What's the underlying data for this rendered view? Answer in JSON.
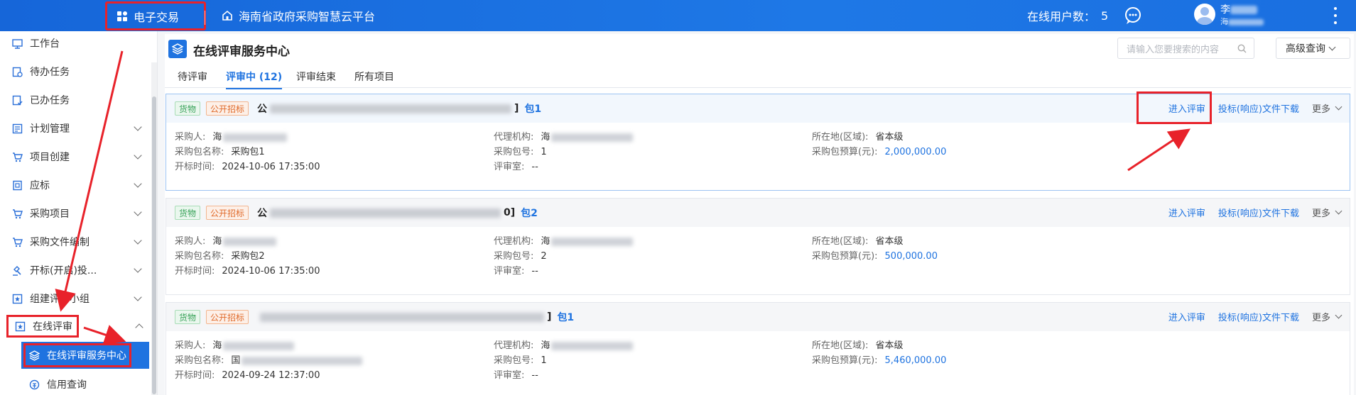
{
  "topbar": {
    "app_label": "电子交易",
    "platform_label": "海南省政府采购智慧云平台",
    "online_label": "在线用户数：",
    "online_count": "5",
    "user_name": "李",
    "user_org": "海"
  },
  "sidebar": {
    "items": [
      {
        "label": "工作台"
      },
      {
        "label": "待办任务"
      },
      {
        "label": "已办任务"
      },
      {
        "label": "计划管理"
      },
      {
        "label": "项目创建"
      },
      {
        "label": "应标"
      },
      {
        "label": "采购项目"
      },
      {
        "label": "采购文件编制"
      },
      {
        "label": "开标(开启)投..."
      },
      {
        "label": "组建评审小组"
      },
      {
        "label": "在线评审"
      },
      {
        "label": "在线评审服务中心"
      },
      {
        "label": "信用查询"
      }
    ]
  },
  "main": {
    "title": "在线评审服务中心",
    "search_placeholder": "请输入您要搜索的内容",
    "advanced_label": "高级查询",
    "tabs": [
      {
        "label": "待评审"
      },
      {
        "label": "评审中 (12)"
      },
      {
        "label": "评审结束"
      },
      {
        "label": "所有项目"
      }
    ],
    "actions": {
      "enter": "进入评审",
      "download": "投标(响应)文件下载",
      "more": "更多"
    },
    "field_labels": {
      "purchaser": "采购人:",
      "agency": "代理机构:",
      "region": "所在地(区域):",
      "pkg_name": "采购包名称:",
      "pkg_no": "采购包号:",
      "budget": "采购包预算(元):",
      "open_time": "开标时间:",
      "room": "评审室:"
    },
    "cards": [
      {
        "tag_goods": "货物",
        "tag_bid": "公开招标",
        "project_prefix": "公",
        "project_suffix": "]",
        "pkg": "包1",
        "purchaser": "海",
        "agency": "海",
        "region": "省本级",
        "pkg_name": "采购包1",
        "pkg_no": "1",
        "budget": "2,000,000.00",
        "open_time": "2024-10-06 17:35:00",
        "room": "--"
      },
      {
        "tag_goods": "货物",
        "tag_bid": "公开招标",
        "project_prefix": "公",
        "project_suffix": "0]",
        "pkg": "包2",
        "purchaser": "海",
        "agency": "海",
        "region": "省本级",
        "pkg_name": "采购包2",
        "pkg_no": "2",
        "budget": "500,000.00",
        "open_time": "2024-10-06 17:35:00",
        "room": "--"
      },
      {
        "tag_goods": "货物",
        "tag_bid": "公开招标",
        "project_prefix": "",
        "project_suffix": "]",
        "pkg": "包1",
        "purchaser": "海",
        "agency": "海",
        "region": "省本级",
        "pkg_name": "国",
        "pkg_no": "1",
        "budget": "5,460,000.00",
        "open_time": "2024-09-24 12:37:00",
        "room": "--"
      }
    ]
  },
  "colors": {
    "primary": "#1f73e0",
    "annotation_red": "#e8222a"
  }
}
